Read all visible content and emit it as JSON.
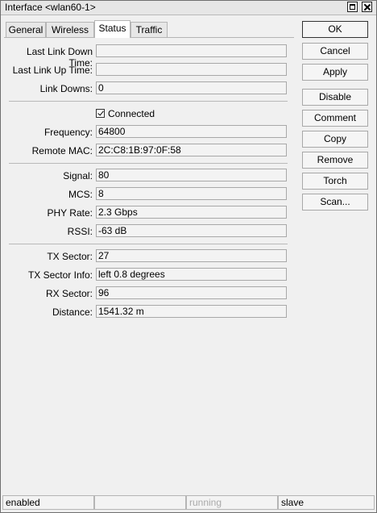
{
  "window": {
    "title": "Interface <wlan60-1>"
  },
  "tabs": [
    {
      "label": "General"
    },
    {
      "label": "Wireless"
    },
    {
      "label": "Status"
    },
    {
      "label": "Traffic"
    }
  ],
  "fields": {
    "last_link_down_time": {
      "label": "Last Link Down Time:",
      "value": ""
    },
    "last_link_up_time": {
      "label": "Last Link Up Time:",
      "value": ""
    },
    "link_downs": {
      "label": "Link Downs:",
      "value": "0"
    },
    "connected": {
      "label": "Connected",
      "checked": true
    },
    "frequency": {
      "label": "Frequency:",
      "value": "64800"
    },
    "remote_mac": {
      "label": "Remote MAC:",
      "value": "2C:C8:1B:97:0F:58"
    },
    "signal": {
      "label": "Signal:",
      "value": "80"
    },
    "mcs": {
      "label": "MCS:",
      "value": "8"
    },
    "phy_rate": {
      "label": "PHY Rate:",
      "value": "2.3 Gbps"
    },
    "rssi": {
      "label": "RSSI:",
      "value": "-63 dB"
    },
    "tx_sector": {
      "label": "TX Sector:",
      "value": "27"
    },
    "tx_sector_info": {
      "label": "TX Sector Info:",
      "value": "left 0.8 degrees"
    },
    "rx_sector": {
      "label": "RX Sector:",
      "value": "96"
    },
    "distance": {
      "label": "Distance:",
      "value": "1541.32 m"
    }
  },
  "buttons": {
    "ok": "OK",
    "cancel": "Cancel",
    "apply": "Apply",
    "disable": "Disable",
    "comment": "Comment",
    "copy": "Copy",
    "remove": "Remove",
    "torch": "Torch",
    "scan": "Scan..."
  },
  "statusbar": {
    "cell1": "enabled",
    "cell2": "",
    "cell3": "running",
    "cell4": "slave"
  }
}
